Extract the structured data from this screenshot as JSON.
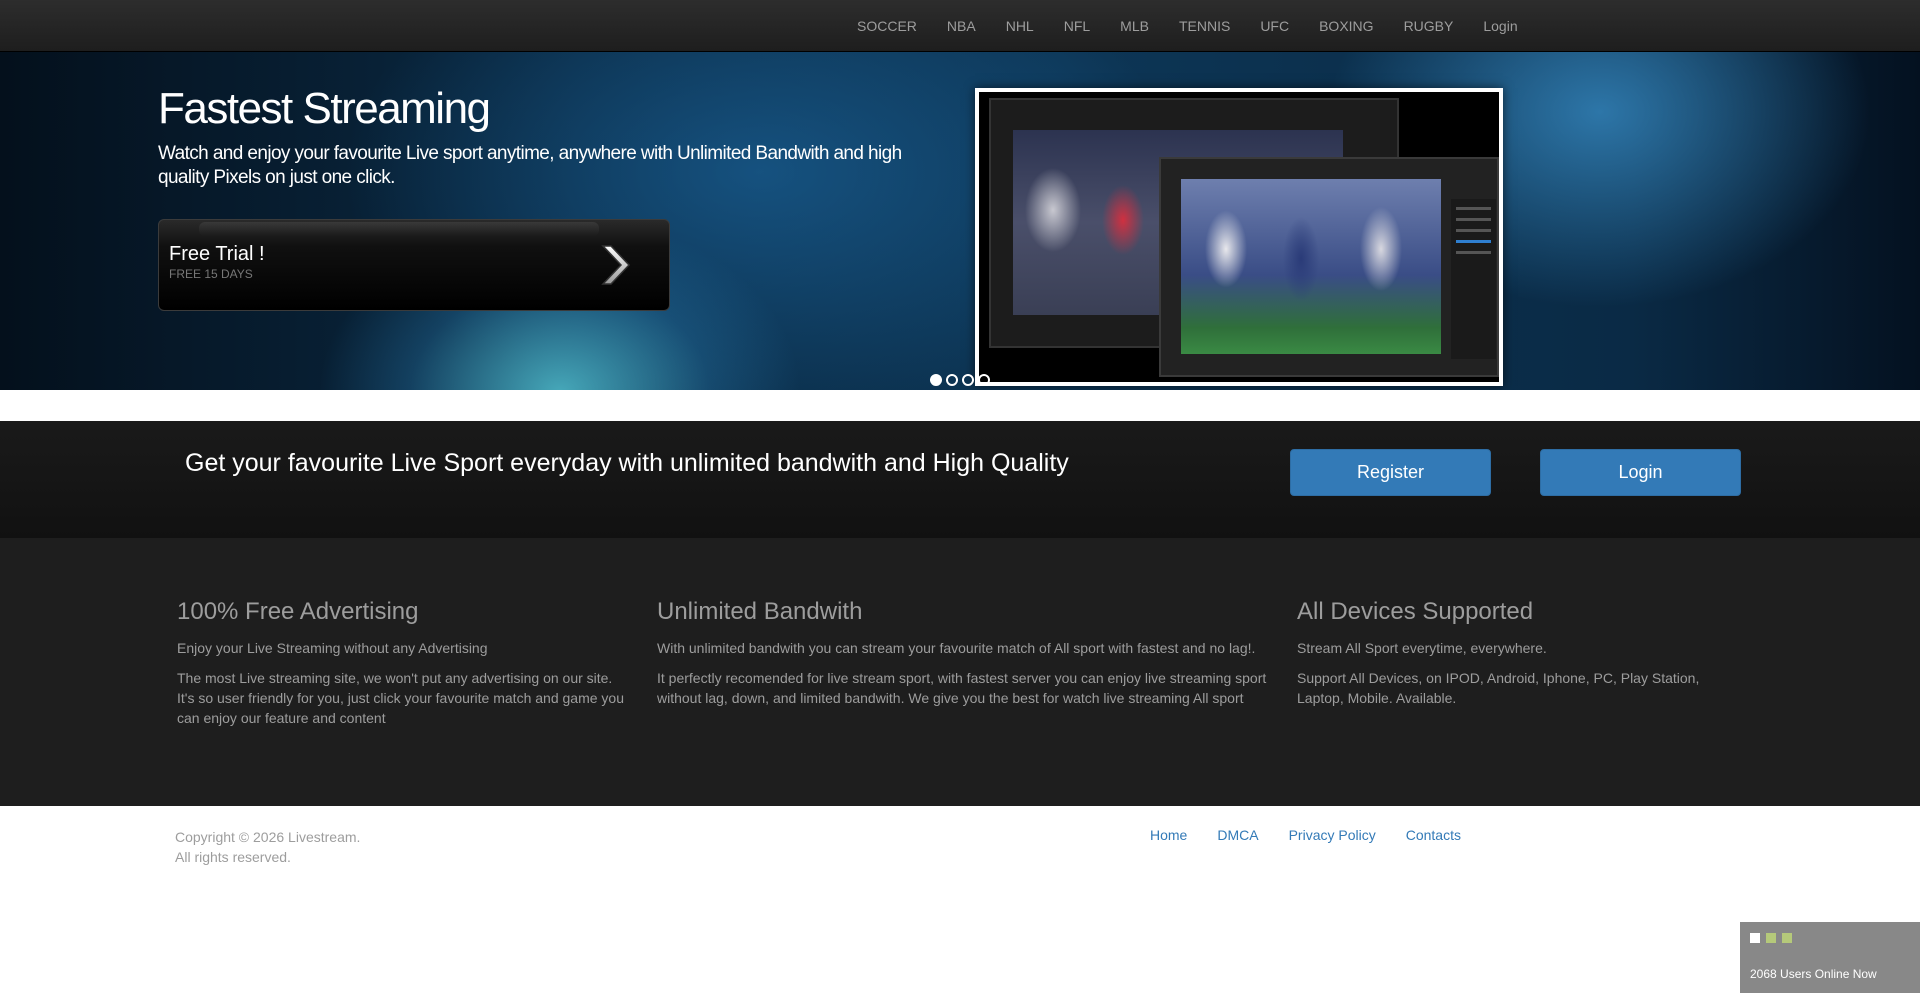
{
  "nav": {
    "items": [
      "SOCCER",
      "NBA",
      "NHL",
      "NFL",
      "MLB",
      "TENNIS",
      "UFC",
      "BOXING",
      "RUGBY",
      "Login"
    ]
  },
  "hero": {
    "title": "Fastest Streaming",
    "subtitle": "Watch and enjoy your favourite Live sport anytime, anywhere with Unlimited Bandwith and high quality Pixels on just one click.",
    "trial_title": "Free Trial !",
    "trial_sub": "FREE 15 DAYS",
    "slides": 4,
    "active_slide": 1
  },
  "cta": {
    "text": "Get your favourite Live Sport everyday with unlimited bandwith and High Quality",
    "register_label": "Register",
    "login_label": "Login",
    "button_color": "#337ab7"
  },
  "features": [
    {
      "title": "100% Free Advertising",
      "lead": "Enjoy your Live Streaming without any Advertising",
      "body": "The most Live streaming site, we won't put any advertising on our site. It's so user friendly for you, just click your favourite match and game you can enjoy our feature and content"
    },
    {
      "title": "Unlimited Bandwith",
      "lead": "With unlimited bandwith you can stream your favourite match of All sport with fastest and no lag!.",
      "body": "It perfectly recomended for live stream sport, with fastest server you can enjoy live streaming sport without lag, down, and limited bandwith. We give you the best for watch live streaming All sport"
    },
    {
      "title": "All Devices Supported",
      "lead": "Stream All Sport everytime, everywhere.",
      "body": "Support All Devices, on IPOD, Android, Iphone, PC, Play Station, Laptop, Mobile. Available."
    }
  ],
  "footer": {
    "copyright_line1": "Copyright © 2026 Livestream.",
    "copyright_line2": "All rights reserved.",
    "links": [
      "Home",
      "DMCA",
      "Privacy Policy",
      "Contacts"
    ],
    "link_color": "#337ab7"
  },
  "online_widget": {
    "text": "2068 Users Online Now"
  }
}
